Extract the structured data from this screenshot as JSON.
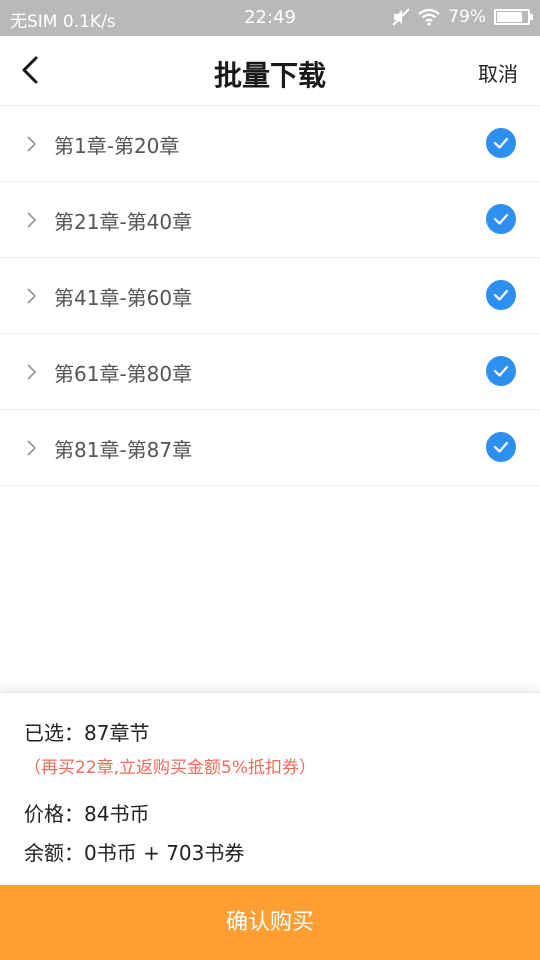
{
  "status_bar": {
    "carrier": "无SIM",
    "speed": "0.1K/s",
    "time": "22:49",
    "battery_text": "79%",
    "icons": [
      "mute-icon",
      "wifi-icon",
      "battery-icon"
    ]
  },
  "header": {
    "title": "批量下载",
    "cancel_label": "取消",
    "back_icon": "chevron-left-icon"
  },
  "chapters": [
    {
      "label": "第1章-第20章",
      "checked": true
    },
    {
      "label": "第21章-第40章",
      "checked": true
    },
    {
      "label": "第41章-第60章",
      "checked": true
    },
    {
      "label": "第61章-第80章",
      "checked": true
    },
    {
      "label": "第81章-第87章",
      "checked": true
    }
  ],
  "summary": {
    "selected": "已选：87章节",
    "promo": "（再买22章,立返购买金额5%抵扣券）",
    "price": "价格：84书币",
    "balance": "余额：0书币 + 703书券"
  },
  "confirm_label": "确认购买",
  "colors": {
    "accent_orange": "#ff9f33",
    "check_blue": "#2d8ff0",
    "promo_red": "#ef6b5b",
    "status_bar_gray": "#b9b9b9"
  }
}
